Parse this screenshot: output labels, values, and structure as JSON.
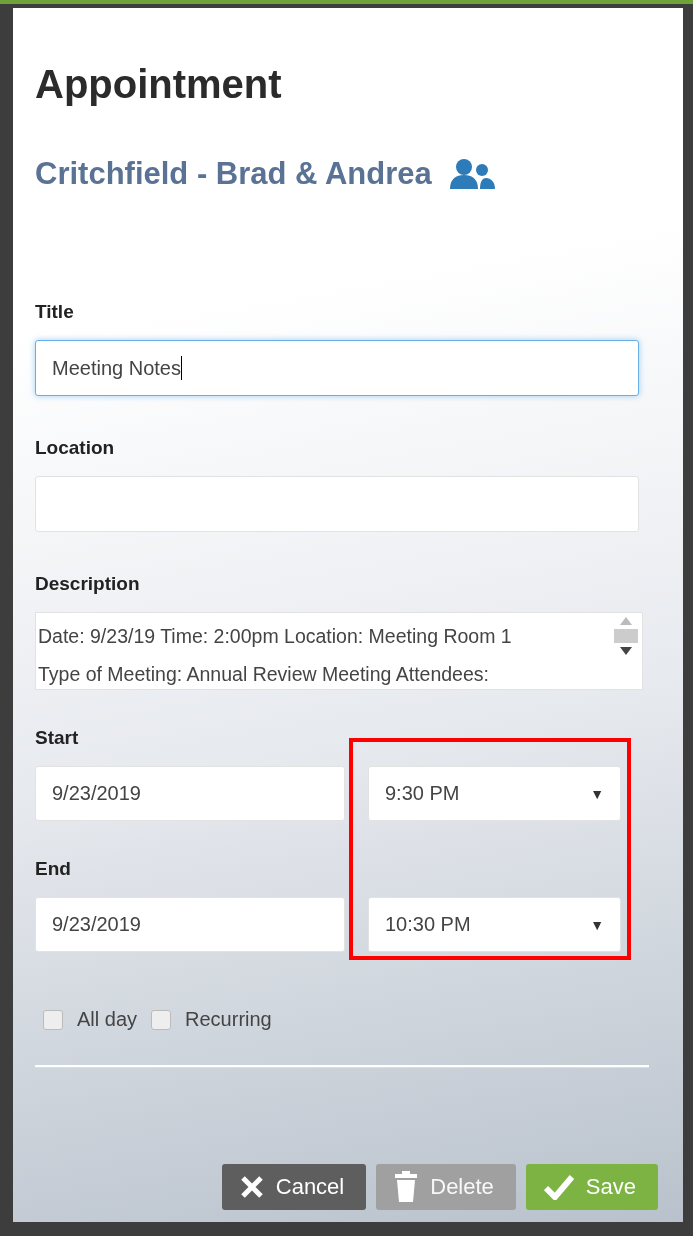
{
  "dialog": {
    "title": "Appointment",
    "contact": "Critchfield - Brad & Andrea"
  },
  "fields": [
    {
      "label": "Title",
      "value": "Meeting Notes",
      "focused": true
    },
    {
      "label": "Location",
      "focused": false
    }
  ],
  "description": {
    "label": "Description",
    "lines": [
      "Date: 9/23/19 Time: 2:00pm Location: Meeting Room 1",
      "Type of Meeting: Annual Review Meeting Attendees:"
    ]
  },
  "times": [
    {
      "label": "Start",
      "date": "9/23/2019",
      "time": "9:30 PM",
      "caret": "▼"
    },
    {
      "label": "End",
      "date": "9/23/2019",
      "time": "10:30 PM",
      "caret": "▼"
    }
  ],
  "options": [
    {
      "label": "All day",
      "checked": false
    },
    {
      "label": "Recurring",
      "checked": false
    }
  ],
  "buttons": [
    {
      "kind": "cancel",
      "label": "Cancel",
      "disabled": false
    },
    {
      "kind": "delete",
      "label": "Delete",
      "disabled": true
    },
    {
      "kind": "save",
      "label": "Save",
      "disabled": false
    }
  ]
}
